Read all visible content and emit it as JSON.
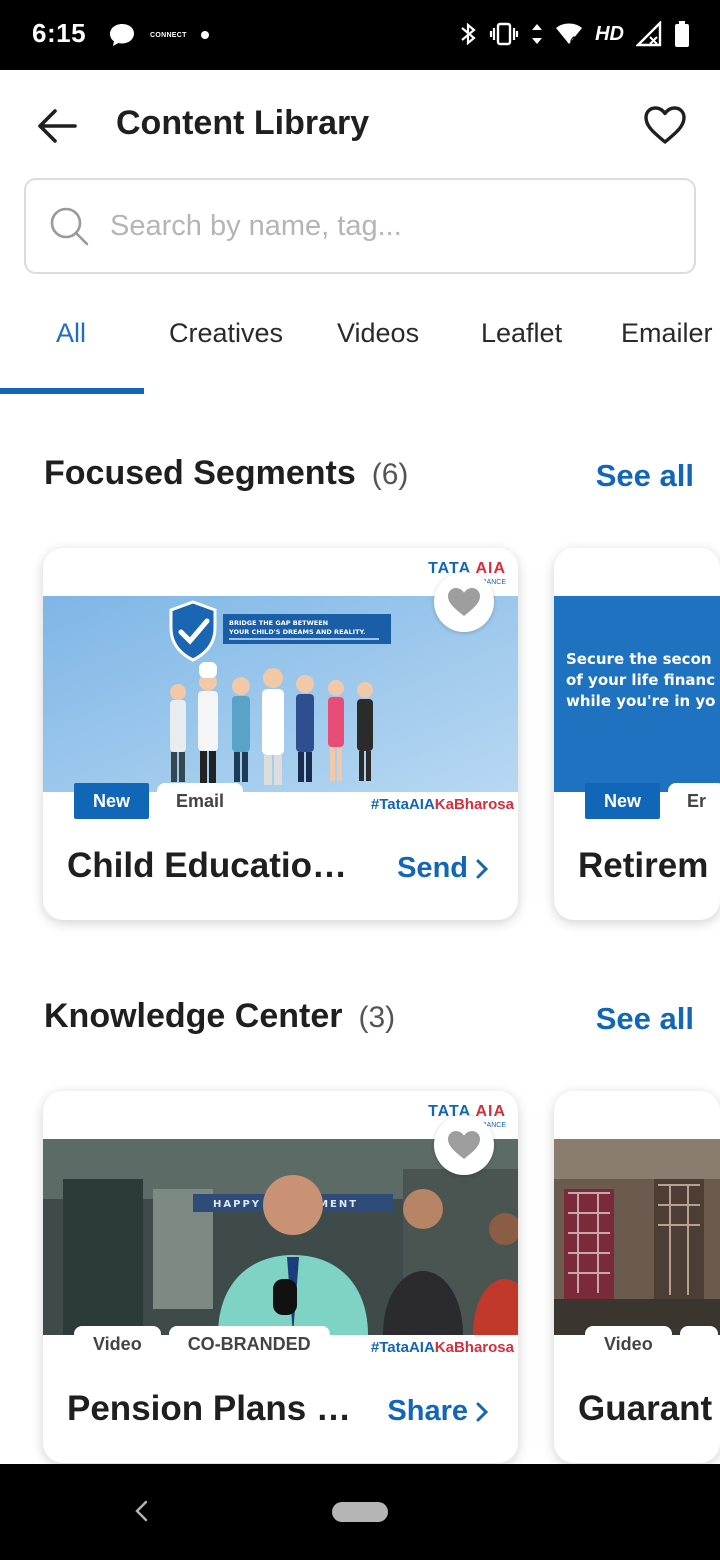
{
  "status_bar": {
    "time": "6:15",
    "left_icons": [
      "chat-bubble-icon",
      "connect-icon",
      "dot-icon"
    ],
    "connect_text": "CONNECT",
    "network_type": "HD",
    "right_icons": [
      "bluetooth-icon",
      "vibrate-icon",
      "data-arrows-icon",
      "wifi-icon",
      "signal-icon",
      "battery-icon"
    ]
  },
  "app_bar": {
    "title": "Content Library",
    "back_icon": "arrow-left-icon",
    "favorite_icon": "heart-outline-icon"
  },
  "search": {
    "placeholder": "Search by name, tag...",
    "value": ""
  },
  "tabs": [
    {
      "label": "All",
      "active": true
    },
    {
      "label": "Creatives",
      "active": false
    },
    {
      "label": "Videos",
      "active": false
    },
    {
      "label": "Leaflet",
      "active": false
    },
    {
      "label": "Emailer",
      "active": false
    }
  ],
  "sections": [
    {
      "title": "Focused Segments",
      "count": "(6)",
      "see_all": "See all",
      "cards": [
        {
          "logo": {
            "tata": "TATA",
            "aia": "AIA",
            "sub": "LIFE INSURANCE"
          },
          "banner_text": [
            "BRIDGE THE GAP BETWEEN",
            "YOUR CHILD'S DREAMS AND REALITY."
          ],
          "tags": [
            "New",
            "Email"
          ],
          "hashtag": {
            "prefix": "#TataAIA",
            "suffix": "KaBharosa"
          },
          "title": "Child Education…",
          "action": "Send"
        },
        {
          "banner_text": [
            "Secure the secon",
            "of your life financ",
            "while you're in yo"
          ],
          "tags": [
            "New",
            "Er"
          ],
          "title": "Retirem"
        }
      ]
    },
    {
      "title": "Knowledge Center",
      "count": "(3)",
      "see_all": "See all",
      "cards": [
        {
          "logo": {
            "tata": "TATA",
            "aia": "AIA",
            "sub": "LIFE INSURANCE"
          },
          "banner_sign": "HAPPY RETIREMENT",
          "tags": [
            "Video",
            "CO-BRANDED"
          ],
          "hashtag": {
            "prefix": "#TataAIA",
            "suffix": "KaBharosa"
          },
          "title": "Pension Plans (…",
          "action": "Share"
        },
        {
          "tags": [
            "Video",
            ""
          ],
          "title": "Guarant"
        }
      ]
    }
  ],
  "colors": {
    "accent": "#1266b7",
    "tata_red": "#d72e3c",
    "text_primary": "#1f1f1f",
    "status_bar": "#000000"
  }
}
